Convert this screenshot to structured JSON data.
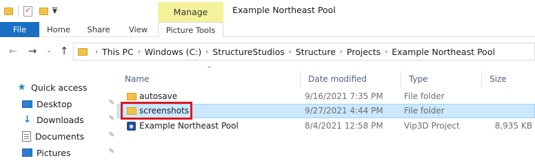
{
  "window": {
    "title": "Example Northeast Pool",
    "context_tab_group": "Manage"
  },
  "ribbon": {
    "tabs": [
      {
        "label": "File",
        "active": true
      },
      {
        "label": "Home"
      },
      {
        "label": "Share"
      },
      {
        "label": "View"
      },
      {
        "label": "Picture Tools"
      }
    ]
  },
  "address_bar": {
    "breadcrumbs": [
      "This PC",
      "Windows (C:)",
      "StructureStudios",
      "Structure",
      "Projects",
      "Example Northeast Pool"
    ]
  },
  "nav_pane": {
    "items": [
      {
        "label": "Quick access",
        "icon": "star-icon",
        "pinned": false
      },
      {
        "label": "Desktop",
        "icon": "desktop-icon",
        "pinned": true
      },
      {
        "label": "Downloads",
        "icon": "download-icon",
        "pinned": true
      },
      {
        "label": "Documents",
        "icon": "documents-icon",
        "pinned": true
      },
      {
        "label": "Pictures",
        "icon": "pictures-icon",
        "pinned": true
      }
    ]
  },
  "file_list": {
    "columns": [
      "Name",
      "Date modified",
      "Type",
      "Size"
    ],
    "rows": [
      {
        "name": "autosave",
        "date": "9/16/2021 7:35 PM",
        "type": "File folder",
        "size": "",
        "icon": "folder-icon",
        "selected": false
      },
      {
        "name": "screenshots",
        "date": "9/27/2021 4:44 PM",
        "type": "File folder",
        "size": "",
        "icon": "folder-icon",
        "selected": true
      },
      {
        "name": "Example Northeast Pool",
        "date": "8/4/2021 12:58 PM",
        "type": "Vip3D Project",
        "size": "8,935 KB",
        "icon": "vip3d-file-icon",
        "selected": false
      }
    ]
  },
  "colors": {
    "file_tab": "#1a6fc2",
    "manage_tab": "#f4f29a",
    "selection": "#cce8ff",
    "highlight": "#e0151a"
  }
}
